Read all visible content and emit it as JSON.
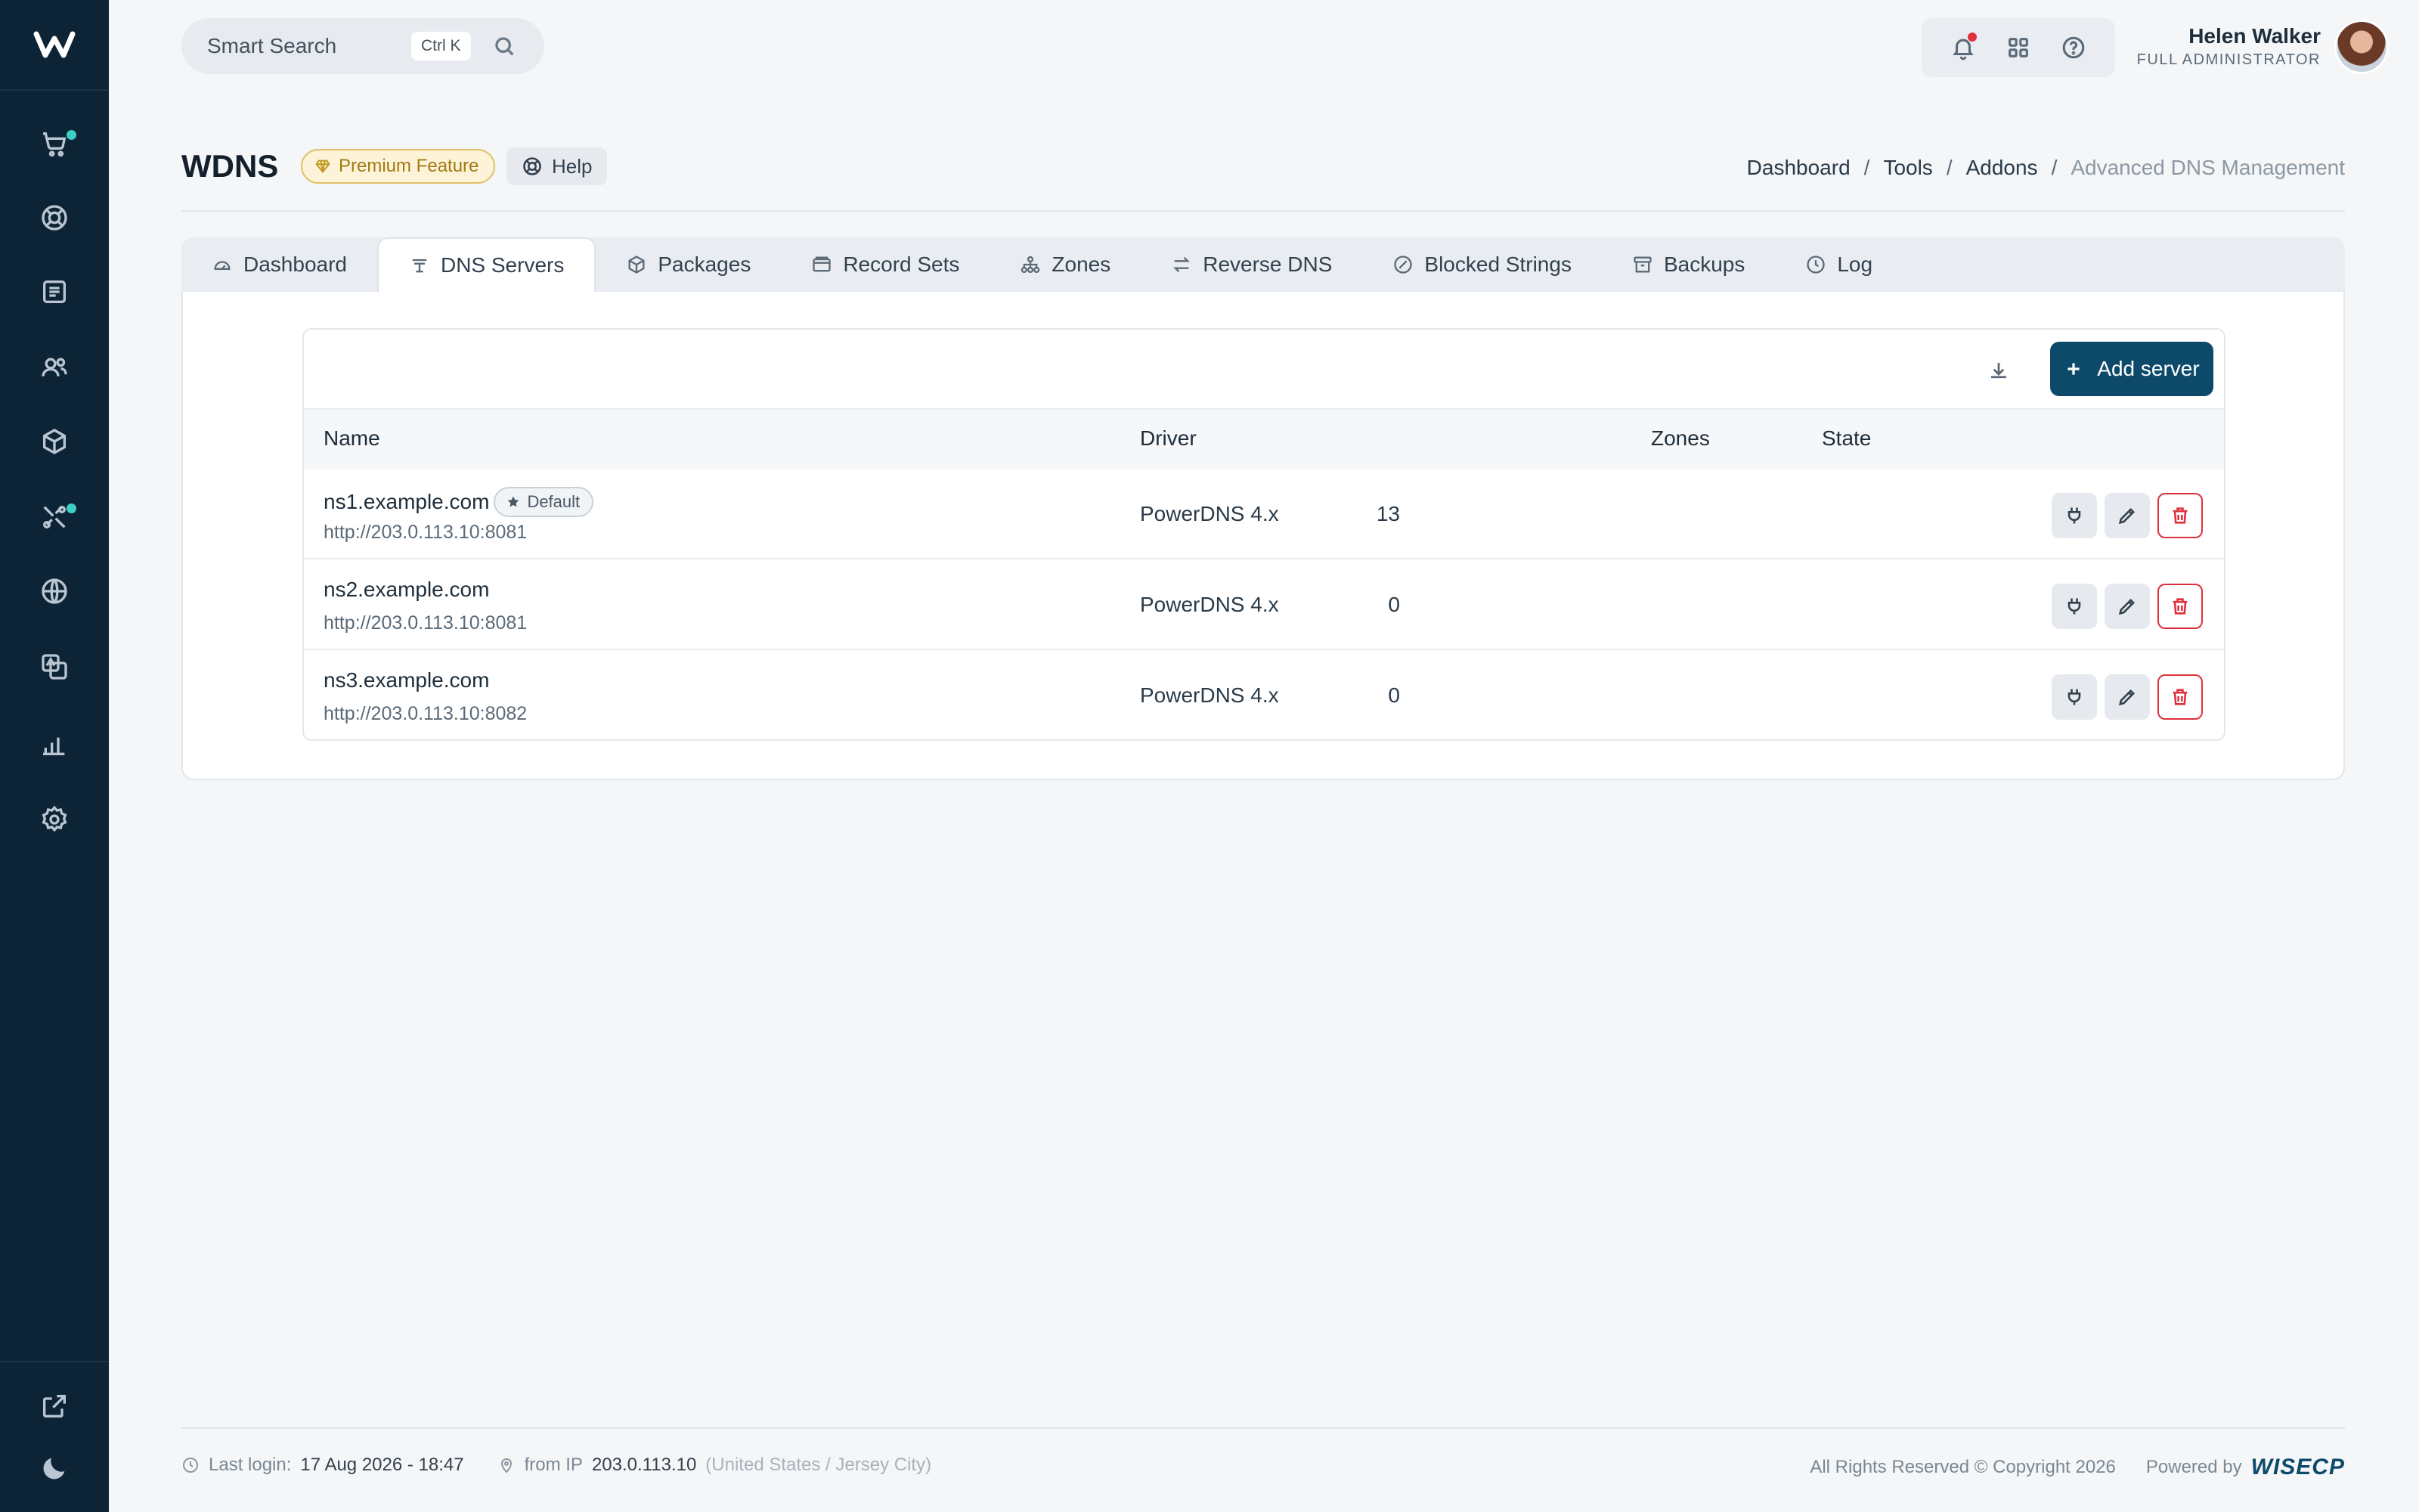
{
  "app": {
    "logo_letter": "W"
  },
  "search": {
    "placeholder": "Smart Search",
    "shortcut": "Ctrl K"
  },
  "user": {
    "name": "Helen Walker",
    "role": "FULL ADMINISTRATOR"
  },
  "page": {
    "title": "WDNS",
    "premium_label": "Premium Feature",
    "help_label": "Help"
  },
  "breadcrumb": [
    "Dashboard",
    "Tools",
    "Addons",
    "Advanced DNS Management"
  ],
  "tabs": [
    {
      "label": "Dashboard",
      "icon": "gauge-icon"
    },
    {
      "label": "DNS Servers",
      "icon": "server-icon",
      "active": true
    },
    {
      "label": "Packages",
      "icon": "box-icon"
    },
    {
      "label": "Record Sets",
      "icon": "folder-icon"
    },
    {
      "label": "Zones",
      "icon": "hierarchy-icon"
    },
    {
      "label": "Reverse DNS",
      "icon": "swap-icon"
    },
    {
      "label": "Blocked Strings",
      "icon": "block-icon"
    },
    {
      "label": "Backups",
      "icon": "archive-icon"
    },
    {
      "label": "Log",
      "icon": "clock-icon"
    }
  ],
  "table": {
    "add_label": "Add server",
    "columns": [
      "Name",
      "Driver",
      "Zones",
      "State"
    ],
    "rows": [
      {
        "name": "ns1.example.com",
        "url": "http://203.0.113.10:8081",
        "driver": "PowerDNS 4.x",
        "zones": "13",
        "default_badge": "Default"
      },
      {
        "name": "ns2.example.com",
        "url": "http://203.0.113.10:8081",
        "driver": "PowerDNS 4.x",
        "zones": "0"
      },
      {
        "name": "ns3.example.com",
        "url": "http://203.0.113.10:8082",
        "driver": "PowerDNS 4.x",
        "zones": "0"
      }
    ]
  },
  "footer": {
    "last_login_label": "Last login:",
    "last_login_value": "17 Aug 2026 - 18:47",
    "ip_label": "from IP",
    "ip_value": "203.0.113.10",
    "ip_location": "(United States / Jersey City)",
    "copyright": "All Rights Reserved © Copyright 2026",
    "powered_by": "Powered by",
    "brand": "WISECP"
  },
  "colors": {
    "sidebar": "#0d2436",
    "primary": "#0d4a6a",
    "danger": "#e0303c",
    "notify_dot": "#3ccfc2"
  }
}
